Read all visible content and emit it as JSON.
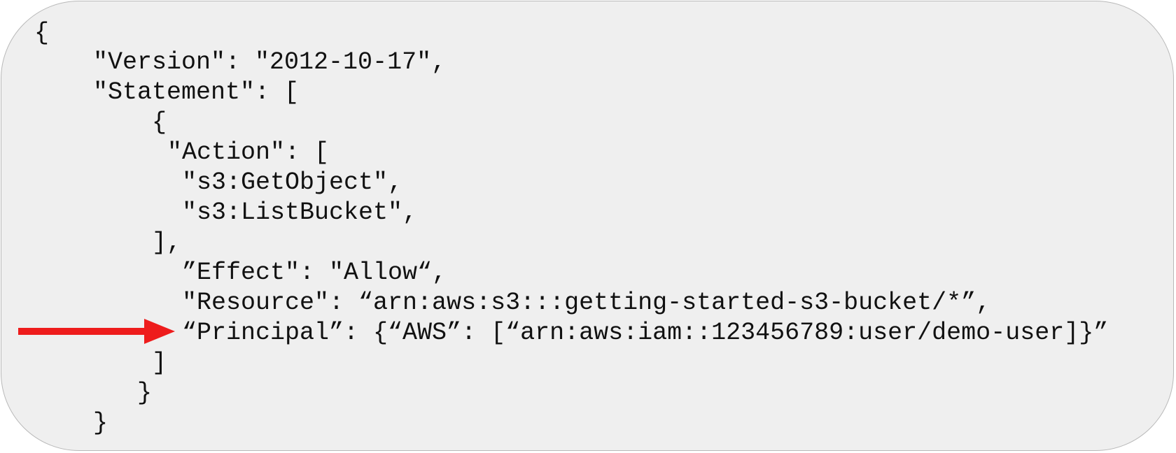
{
  "code": {
    "lines": [
      "{",
      "\"Version\": \"2012-10-17\",",
      "\"Statement\": [",
      "{",
      "\"Action\": [",
      "\"s3:GetObject\",",
      "\"s3:ListBucket\",",
      "],",
      "”Effect\": \"Allow“,",
      "\"Resource\": “arn:aws:s3:::getting-started-s3-bucket/*”,",
      "“Principal”: {“AWS”: [“arn:aws:iam::123456789:user/demo-user]}”",
      "]",
      "}",
      "}"
    ]
  },
  "annotation": {
    "arrow_color": "#ee1c1c"
  },
  "colors": {
    "panel_background": "#efefef",
    "panel_border": "#b9b9b9",
    "text": "#111111"
  }
}
